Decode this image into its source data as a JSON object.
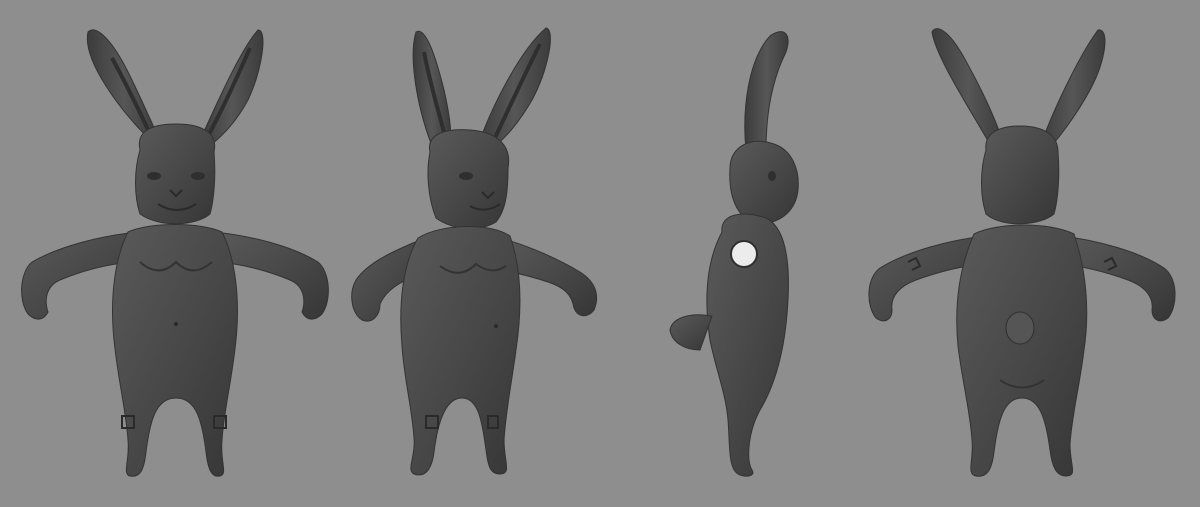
{
  "scene": {
    "background": "#8e8e8e",
    "model_color": "#4a4a4a",
    "shadow_color": "#3a3a3a",
    "highlight_color": "#5e5e5e",
    "views": [
      {
        "view": "front",
        "icon": "rabbit-front-icon"
      },
      {
        "view": "three-quarter",
        "icon": "rabbit-three-quarter-icon"
      },
      {
        "view": "side",
        "icon": "rabbit-side-icon"
      },
      {
        "view": "back",
        "icon": "rabbit-back-icon"
      }
    ]
  }
}
